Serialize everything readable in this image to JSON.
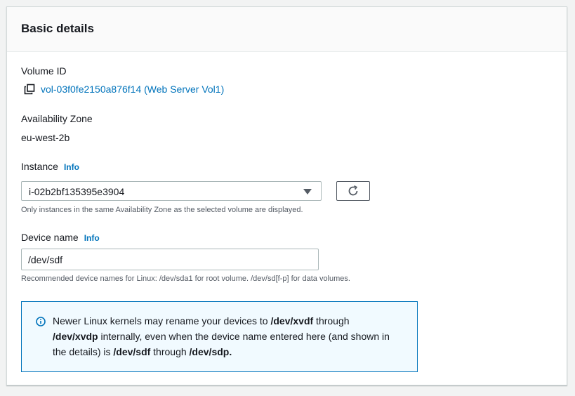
{
  "panel": {
    "title": "Basic details"
  },
  "volume": {
    "label": "Volume ID",
    "link_text": "vol-03f0fe2150a876f14 (Web Server Vol1)",
    "icon": "copy-icon"
  },
  "availability_zone": {
    "label": "Availability Zone",
    "value": "eu-west-2b"
  },
  "instance": {
    "label": "Instance",
    "info": "Info",
    "selected": "i-02b2bf135395e3904",
    "hint": "Only instances in the same Availability Zone as the selected volume are displayed.",
    "refresh_icon": "refresh-icon"
  },
  "device_name": {
    "label": "Device name",
    "info": "Info",
    "value": "/dev/sdf",
    "hint": "Recommended device names for Linux: /dev/sda1 for root volume. /dev/sd[f-p] for data volumes."
  },
  "alert": {
    "icon": "info-icon",
    "part1": "Newer Linux kernels may rename your devices to ",
    "code1": "/dev/xvdf",
    "part2": " through ",
    "code2": "/dev/xvdp",
    "part3": " internally, even when the device name entered here (and shown in the details) is ",
    "code3": "/dev/sdf",
    "part4": " through ",
    "code4": "/dev/sdp."
  },
  "colors": {
    "link": "#0073bb",
    "alert_border": "#0073bb",
    "alert_background": "#f1faff"
  }
}
